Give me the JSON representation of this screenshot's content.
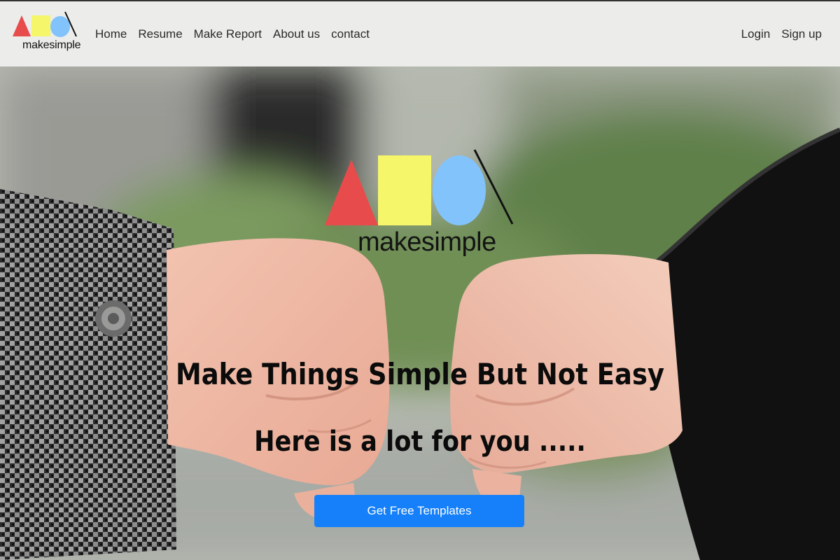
{
  "brand": {
    "name": "makesimple",
    "logo_colors": {
      "triangle": "#e84b4b",
      "square": "#f5f66a",
      "circle": "#82c3fb",
      "slash": "#111111"
    }
  },
  "nav": {
    "links": [
      {
        "label": "Home"
      },
      {
        "label": "Resume"
      },
      {
        "label": "Make Report"
      },
      {
        "label": "About us"
      },
      {
        "label": "contact"
      }
    ],
    "auth": [
      {
        "label": "Login"
      },
      {
        "label": "Sign up"
      }
    ]
  },
  "hero": {
    "logo_text": "makesimple",
    "headline": "Make Things Simple But Not Easy",
    "subheadline": "Here is a lot for you .....",
    "cta_label": "Get Free Templates",
    "cta_color": "#1580f9"
  }
}
